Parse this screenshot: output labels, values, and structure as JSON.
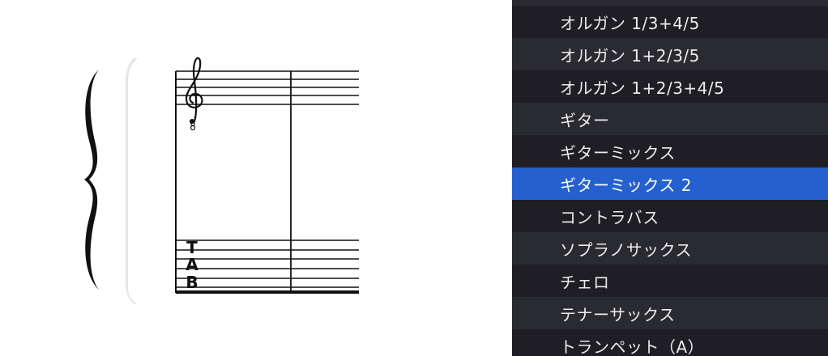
{
  "score": {
    "clef_icon": "treble-clef-8vb-icon",
    "tab_letters": [
      "T",
      "A",
      "B"
    ]
  },
  "instrument_menu": {
    "selected_index": 6,
    "items": [
      {
        "label": "オルガン 1/3+4/5"
      },
      {
        "label": "オルガン 1+2/3/5"
      },
      {
        "label": "オルガン 1+2/3+4/5"
      },
      {
        "label": "ギター"
      },
      {
        "label": "ギターミックス"
      },
      {
        "label": "ギターミックス 2"
      },
      {
        "label": "コントラバス"
      },
      {
        "label": "ソプラノサックス"
      },
      {
        "label": "チェロ"
      },
      {
        "label": "テナーサックス"
      },
      {
        "label": "トランペット（A）"
      }
    ],
    "colors": {
      "background": "#1e1e24",
      "alt_row": "#2a2a31",
      "selected": "#2560cf",
      "text": "#ececec"
    }
  }
}
